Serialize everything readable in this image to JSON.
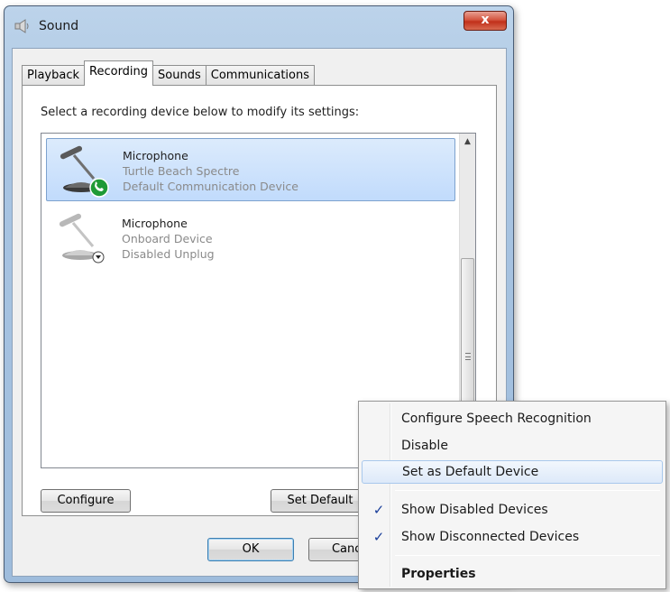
{
  "window": {
    "title": "Sound",
    "close_label": "x"
  },
  "tabs": [
    {
      "label": "Playback"
    },
    {
      "label": "Recording"
    },
    {
      "label": "Sounds"
    },
    {
      "label": "Communications"
    }
  ],
  "panel": {
    "instruction": "Select a recording device below to modify its settings:"
  },
  "devices": [
    {
      "name": "Microphone",
      "sub1": "Turtle Beach Spectre",
      "sub2": "Default Communication Device",
      "selected": true
    },
    {
      "name": "Microphone",
      "sub1": "Onboard Device",
      "sub2": "Disabled Unplug",
      "selected": false
    }
  ],
  "buttons": {
    "configure": "Configure",
    "set_default": "Set Default",
    "ok": "OK",
    "cancel": "Cancel"
  },
  "context_menu": {
    "items": [
      {
        "label": "Configure Speech Recognition"
      },
      {
        "label": "Disable"
      },
      {
        "label": "Set as Default Device"
      },
      {
        "label": "Show Disabled Devices",
        "checked": true
      },
      {
        "label": "Show Disconnected Devices",
        "checked": true
      },
      {
        "label": "Properties"
      }
    ],
    "check_glyph": "✓"
  },
  "colors": {
    "selection": "#c1dbfc",
    "accent_check": "#1a3f9a",
    "close_red": "#c1301a"
  }
}
